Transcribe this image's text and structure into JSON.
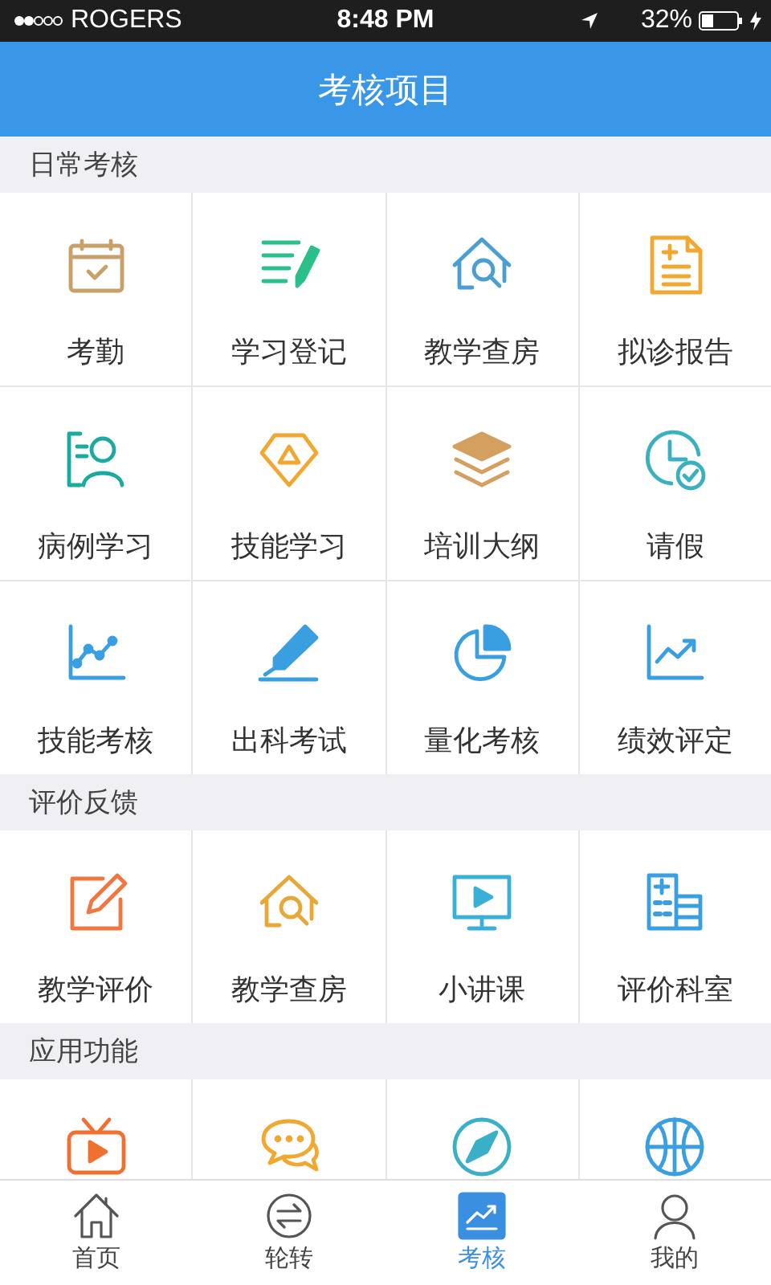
{
  "status_bar": {
    "carrier": "ROGERS",
    "time": "8:48 PM",
    "battery": "32%"
  },
  "header": {
    "title": "考核项目"
  },
  "sections": [
    {
      "title": "日常考核",
      "items": [
        {
          "label": "考勤"
        },
        {
          "label": "学习登记"
        },
        {
          "label": "教学查房"
        },
        {
          "label": "拟诊报告"
        },
        {
          "label": "病例学习"
        },
        {
          "label": "技能学习"
        },
        {
          "label": "培训大纲"
        },
        {
          "label": "请假"
        },
        {
          "label": "技能考核"
        },
        {
          "label": "出科考试"
        },
        {
          "label": "量化考核"
        },
        {
          "label": "绩效评定"
        }
      ]
    },
    {
      "title": "评价反馈",
      "items": [
        {
          "label": "教学评价"
        },
        {
          "label": "教学查房"
        },
        {
          "label": "小讲课"
        },
        {
          "label": "评价科室"
        }
      ]
    },
    {
      "title": "应用功能",
      "items": [
        {
          "kind": "icon"
        },
        {
          "kind": "icon"
        },
        {
          "kind": "icon"
        },
        {
          "kind": "icon"
        }
      ]
    }
  ],
  "tabs": [
    {
      "label": "首页",
      "selected": false
    },
    {
      "label": "轮转",
      "selected": false
    },
    {
      "label": "考核",
      "selected": true
    },
    {
      "label": "我的",
      "selected": false
    }
  ]
}
